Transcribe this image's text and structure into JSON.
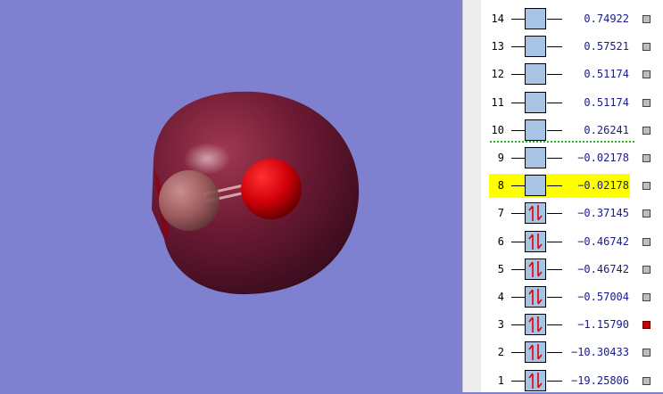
{
  "orbitals": [
    {
      "index": "14",
      "energy": "0.74922",
      "occupied": false,
      "highlight": false,
      "selected": false
    },
    {
      "index": "13",
      "energy": "0.57521",
      "occupied": false,
      "highlight": false,
      "selected": false
    },
    {
      "index": "12",
      "energy": "0.51174",
      "occupied": false,
      "highlight": false,
      "selected": false
    },
    {
      "index": "11",
      "energy": "0.51174",
      "occupied": false,
      "highlight": false,
      "selected": false
    },
    {
      "index": "10",
      "energy": "0.26241",
      "occupied": false,
      "highlight": false,
      "selected": false
    },
    {
      "index": "9",
      "energy": "−0.02178",
      "occupied": false,
      "highlight": false,
      "selected": false
    },
    {
      "index": "8",
      "energy": "−0.02178",
      "occupied": false,
      "highlight": true,
      "selected": false
    },
    {
      "index": "7",
      "energy": "−0.37145",
      "occupied": true,
      "highlight": false,
      "selected": false
    },
    {
      "index": "6",
      "energy": "−0.46742",
      "occupied": true,
      "highlight": false,
      "selected": false
    },
    {
      "index": "5",
      "energy": "−0.46742",
      "occupied": true,
      "highlight": false,
      "selected": false
    },
    {
      "index": "4",
      "energy": "−0.57004",
      "occupied": true,
      "highlight": false,
      "selected": false
    },
    {
      "index": "3",
      "energy": "−1.15790",
      "occupied": true,
      "highlight": false,
      "selected": true
    },
    {
      "index": "2",
      "energy": "−10.30433",
      "occupied": true,
      "highlight": false,
      "selected": false
    },
    {
      "index": "1",
      "energy": "−19.25806",
      "occupied": true,
      "highlight": false,
      "selected": false
    }
  ],
  "colors": {
    "background": "#8080d0",
    "isosurface": "#6a1a30",
    "oxygen_atom": "#d0000a",
    "carbon_atom": "#b07070",
    "orbital_box": "#a8c4e4",
    "highlight": "#ffff00",
    "selected_marker": "#cc0000",
    "divider": "#22bb22",
    "electron_arrow": "#dd0000",
    "energy_text": "#1a1a8c"
  },
  "icons": {
    "occupied": "electron-pair-arrows-icon",
    "marker": "selection-square-icon"
  }
}
